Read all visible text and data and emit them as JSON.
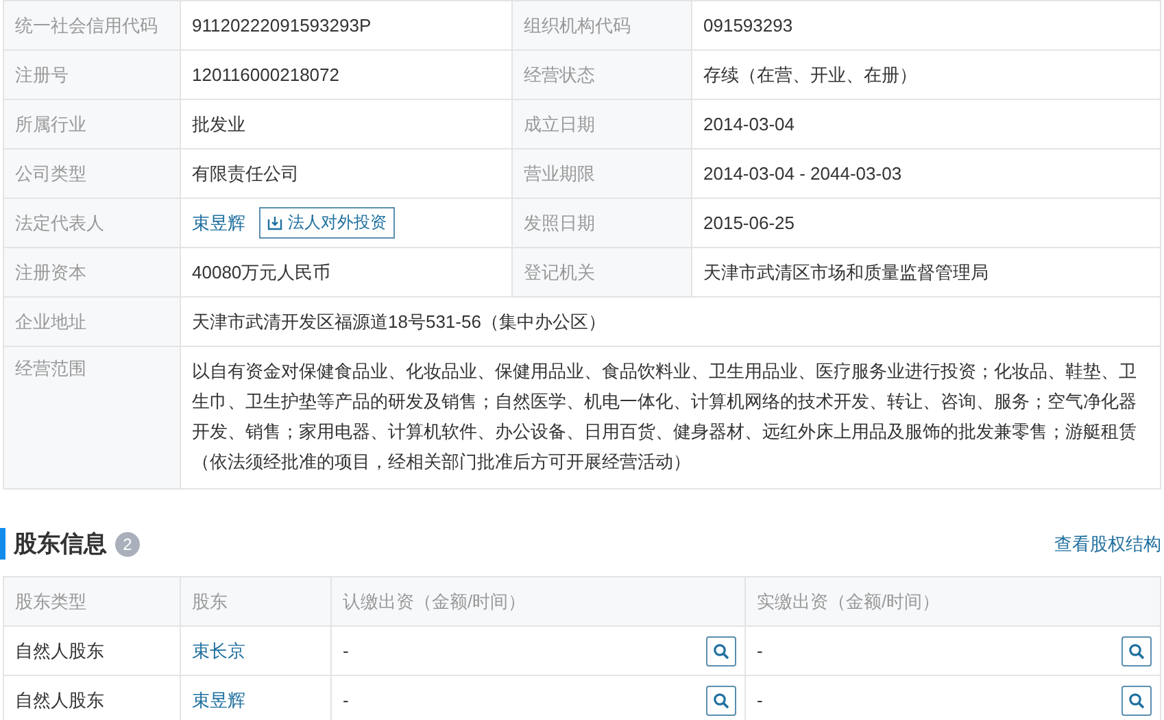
{
  "company_info": {
    "fields": [
      {
        "kind": "text",
        "label": "统一社会信用代码",
        "value": "91120222091593293P"
      },
      {
        "kind": "text",
        "label": "组织机构代码",
        "value": "091593293"
      },
      {
        "kind": "text",
        "label": "注册号",
        "value": "120116000218072"
      },
      {
        "kind": "text",
        "label": "经营状态",
        "value": "存续（在营、开业、在册）"
      },
      {
        "kind": "text",
        "label": "所属行业",
        "value": "批发业"
      },
      {
        "kind": "text",
        "label": "成立日期",
        "value": "2014-03-04"
      },
      {
        "kind": "text",
        "label": "公司类型",
        "value": "有限责任公司"
      },
      {
        "kind": "text",
        "label": "营业期限",
        "value": "2014-03-04 - 2044-03-03"
      },
      {
        "kind": "person",
        "label": "法定代表人",
        "value": "束昱辉",
        "action": "法人对外投资"
      },
      {
        "kind": "text",
        "label": "发照日期",
        "value": "2015-06-25"
      },
      {
        "kind": "text",
        "label": "注册资本",
        "value": "40080万元人民币"
      },
      {
        "kind": "text",
        "label": "登记机关",
        "value": "天津市武清区市场和质量监督管理局"
      },
      {
        "kind": "wide",
        "label": "企业地址",
        "value": "天津市武清开发区福源道18号531-56（集中办公区）"
      },
      {
        "kind": "wide",
        "label": "经营范围",
        "value": "以自有资金对保健食品业、化妆品业、保健用品业、食品饮料业、卫生用品业、医疗服务业进行投资；化妆品、鞋垫、卫生巾、卫生护垫等产品的研发及销售；自然医学、机电一体化、计算机网络的技术开发、转让、咨询、服务；空气净化器开发、销售；家用电器、计算机软件、办公设备、日用百货、健身器材、远红外床上用品及服饰的批发兼零售；游艇租赁（依法须经批准的项目，经相关部门批准后方可开展经营活动）"
      }
    ]
  },
  "shareholders": {
    "title": "股东信息",
    "count": "2",
    "link": "查看股权结构",
    "columns": [
      "股东类型",
      "股东",
      "认缴出资（金额/时间）",
      "实缴出资（金额/时间）"
    ],
    "rows": [
      {
        "type": "自然人股东",
        "name": "束长京",
        "subscribed": "-",
        "paid": "-"
      },
      {
        "type": "自然人股东",
        "name": "束昱辉",
        "subscribed": "-",
        "paid": "-"
      }
    ]
  }
}
